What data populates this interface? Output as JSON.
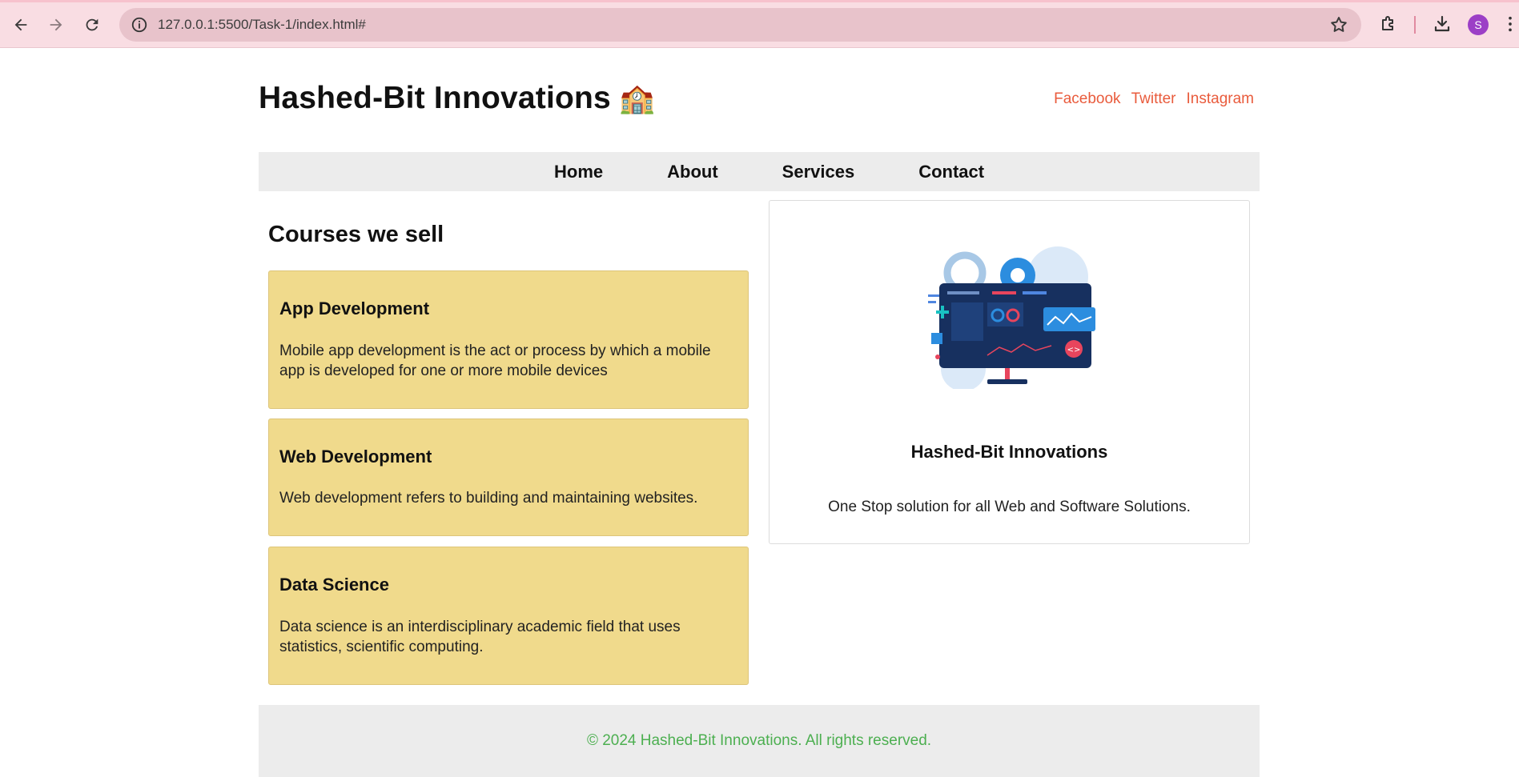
{
  "browser": {
    "url": "127.0.0.1:5500/Task-1/index.html#",
    "profile_initial": "S",
    "icons": [
      "back-icon",
      "forward-icon",
      "reload-icon",
      "info-icon",
      "star-icon",
      "extensions-icon",
      "download-icon",
      "menu-icon"
    ]
  },
  "header": {
    "title": "Hashed-Bit Innovations",
    "emoji": "🏫",
    "social_links": [
      "Facebook",
      "Twitter",
      "Instagram"
    ]
  },
  "nav": {
    "items": [
      "Home",
      "About",
      "Services",
      "Contact"
    ]
  },
  "courses": {
    "heading": "Courses we sell",
    "items": [
      {
        "title": "App Development",
        "description": "Mobile app development is the act or process by which a mobile app is developed for one or more mobile devices"
      },
      {
        "title": "Web Development",
        "description": "Web development refers to building and maintaining websites."
      },
      {
        "title": "Data Science",
        "description": "Data science is an interdisciplinary academic field that uses statistics, scientific computing."
      }
    ]
  },
  "feature": {
    "title": "Hashed-Bit Innovations",
    "description": "One Stop solution for all Web and Software Solutions."
  },
  "footer": {
    "text": "© 2024 Hashed-Bit Innovations. All rights reserved."
  },
  "colors": {
    "chrome_bg": "#f9dde3",
    "social_link": "#e95b3c",
    "card_bg": "#f0da8c",
    "footer_text": "#4caf50",
    "nav_bg": "#ececec"
  }
}
